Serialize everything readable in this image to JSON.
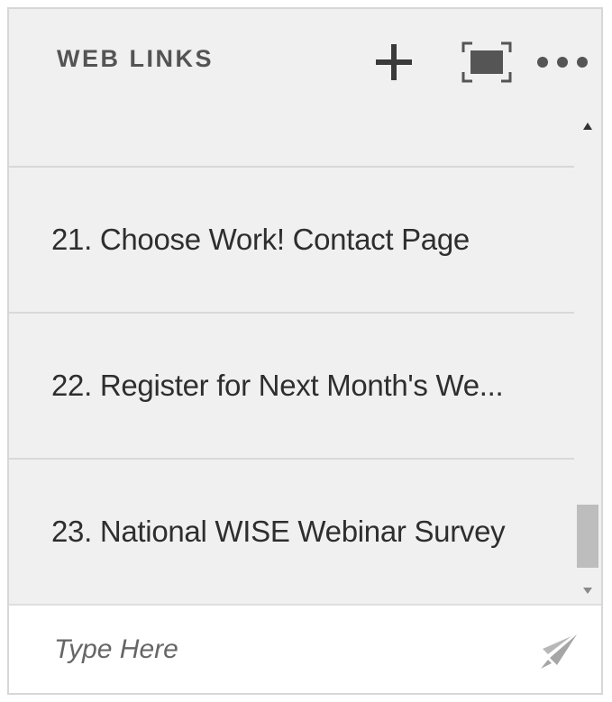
{
  "header": {
    "title": "WEB LINKS",
    "icons": [
      "plus-icon",
      "maximize-icon",
      "more-options-icon"
    ]
  },
  "links": [
    {
      "label": "21. Choose Work! Contact Page"
    },
    {
      "label": "22. Register for Next Month's We..."
    },
    {
      "label": "23. National WISE Webinar Survey"
    }
  ],
  "composer": {
    "placeholder": "Type Here",
    "send_icon": "send-icon"
  },
  "colors": {
    "panel_bg": "#f0f0f0",
    "title": "#545454",
    "text": "#2e2e2e",
    "scroll_thumb": "#bdbdbd"
  }
}
